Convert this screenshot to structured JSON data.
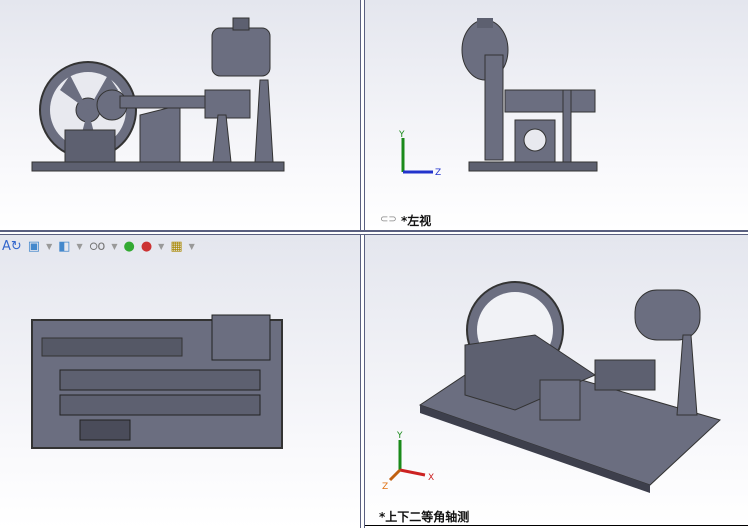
{
  "viewports": {
    "front": {
      "label": ""
    },
    "left": {
      "label": "*左视",
      "link_icon": "link-icon"
    },
    "top": {
      "label": ""
    },
    "iso": {
      "label": "*上下二等角轴测"
    }
  },
  "axes": {
    "x": "X",
    "y": "Y",
    "z": "Z"
  },
  "toolbar": {
    "icons": [
      "rotate-text-icon",
      "section-view-icon",
      "display-style-icon",
      "hide-show-icon",
      "appearance-icon",
      "scene-icon",
      "view-settings-icon"
    ]
  },
  "colors": {
    "model": "#6b6e80",
    "model_dark": "#3d3f4c",
    "border": "#5a6080"
  }
}
